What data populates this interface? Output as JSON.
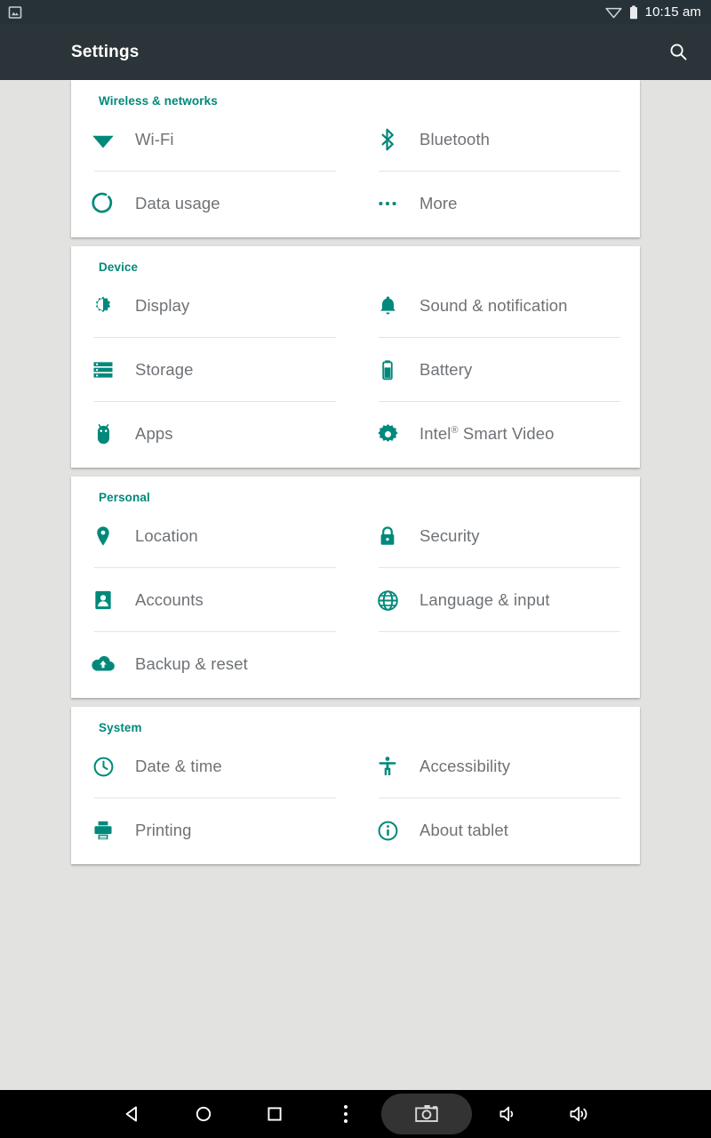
{
  "status_bar": {
    "left_icons": [
      "screenshot-image-icon"
    ],
    "right_icons": [
      "wifi-no-signal-icon",
      "battery-full-icon"
    ],
    "clock": "10:15 am"
  },
  "action_bar": {
    "title": "Settings",
    "search_icon": "search-icon"
  },
  "sections": [
    {
      "header": "Wireless & networks",
      "items": [
        {
          "label": "Wi-Fi",
          "icon": "wifi-icon"
        },
        {
          "label": "Bluetooth",
          "icon": "bluetooth-icon"
        },
        {
          "label": "Data usage",
          "icon": "data-usage-icon"
        },
        {
          "label": "More",
          "icon": "more-dots-icon"
        }
      ]
    },
    {
      "header": "Device",
      "items": [
        {
          "label": "Display",
          "icon": "brightness-icon"
        },
        {
          "label": "Sound & notification",
          "icon": "bell-icon"
        },
        {
          "label": "Storage",
          "icon": "storage-icon"
        },
        {
          "label": "Battery",
          "icon": "battery-icon"
        },
        {
          "label": "Apps",
          "icon": "android-robot-icon"
        },
        {
          "label": "Intel® Smart Video",
          "icon": "gear-icon",
          "sup": "®",
          "base": "Intel",
          "tail": " Smart Video"
        }
      ]
    },
    {
      "header": "Personal",
      "items": [
        {
          "label": "Location",
          "icon": "location-pin-icon"
        },
        {
          "label": "Security",
          "icon": "lock-icon"
        },
        {
          "label": "Accounts",
          "icon": "account-badge-icon"
        },
        {
          "label": "Language & input",
          "icon": "globe-icon"
        },
        {
          "label": "Backup & reset",
          "icon": "cloud-upload-icon"
        }
      ]
    },
    {
      "header": "System",
      "items": [
        {
          "label": "Date & time",
          "icon": "clock-icon"
        },
        {
          "label": "Accessibility",
          "icon": "accessibility-icon"
        },
        {
          "label": "Printing",
          "icon": "printer-icon"
        },
        {
          "label": "About tablet",
          "icon": "info-icon"
        }
      ]
    }
  ],
  "nav_bar": {
    "buttons": [
      {
        "name": "back",
        "icon": "back-triangle-icon"
      },
      {
        "name": "home",
        "icon": "home-circle-icon"
      },
      {
        "name": "recents",
        "icon": "recents-square-icon"
      },
      {
        "name": "menu",
        "icon": "overflow-menu-icon"
      },
      {
        "name": "screenshot",
        "icon": "camera-icon"
      },
      {
        "name": "volume-down",
        "icon": "volume-down-icon"
      },
      {
        "name": "volume-up",
        "icon": "volume-up-icon"
      }
    ]
  },
  "colors": {
    "accent_teal": "#00897b",
    "status_bar": "#263238",
    "action_bar": "#2b3539",
    "background": "#e2e2e0",
    "card": "#ffffff",
    "label_text": "#6e7276"
  }
}
